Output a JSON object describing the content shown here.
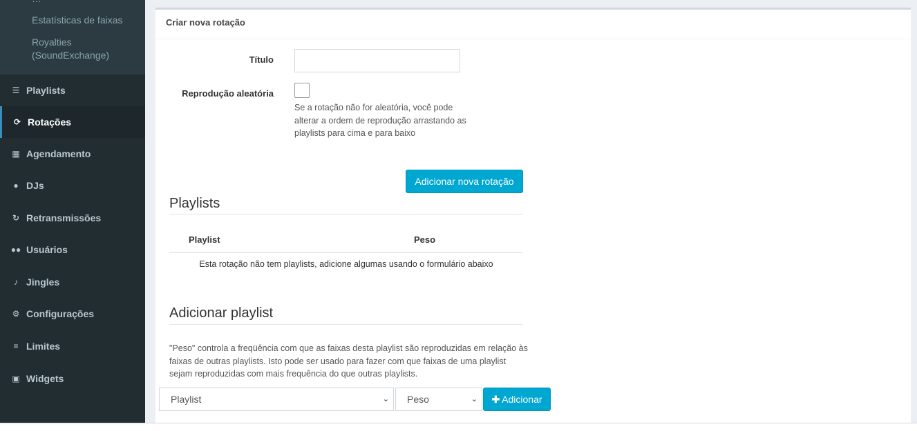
{
  "sidebar": {
    "sub_items": [
      "Estatísticas de faixas",
      "Royalties",
      "(SoundExchange)"
    ],
    "items": [
      {
        "label": "Playlists",
        "icon": "list-icon"
      },
      {
        "label": "Rotações",
        "icon": "refresh-icon"
      },
      {
        "label": "Agendamento",
        "icon": "calendar-icon"
      },
      {
        "label": "DJs",
        "icon": "user-icon"
      },
      {
        "label": "Retransmissões",
        "icon": "repeat-icon"
      },
      {
        "label": "Usuários",
        "icon": "users-icon"
      },
      {
        "label": "Jingles",
        "icon": "bell-icon"
      },
      {
        "label": "Configurações",
        "icon": "cogs-icon"
      },
      {
        "label": "Limites",
        "icon": "list-ol-icon"
      },
      {
        "label": "Widgets",
        "icon": "gift-icon"
      }
    ],
    "active_index": 1
  },
  "form": {
    "header": "Criar nova rotação",
    "title_label": "Título",
    "title_value": "",
    "shuffle_label": "Reprodução aleatória",
    "shuffle_checked": false,
    "shuffle_help": "Se a rotação não for aleatória, você pode alterar a ordem de reprodução arrastando as playlists para cima e para baixo",
    "submit_label": "Adicionar nova rotação"
  },
  "playlists": {
    "title": "Playlists",
    "col_playlist": "Playlist",
    "col_weight": "Peso",
    "empty_text": "Esta rotação não tem playlists, adicione algumas usando o formulário abaixo"
  },
  "add_playlist": {
    "title": "Adicionar playlist",
    "description": "\"Peso\" controla a freqüência com que as faixas desta playlist são reproduzidas em relação às faixas de outras playlists. Isto pode ser usado para fazer com que faixas de uma playlist sejam reproduzidas com mais frequência do que outras playlists.",
    "playlist_select": "Playlist",
    "weight_select": "Peso",
    "add_button": "Adicionar"
  },
  "colors": {
    "sidebar_bg": "#222d32",
    "accent": "#00a7d0"
  }
}
